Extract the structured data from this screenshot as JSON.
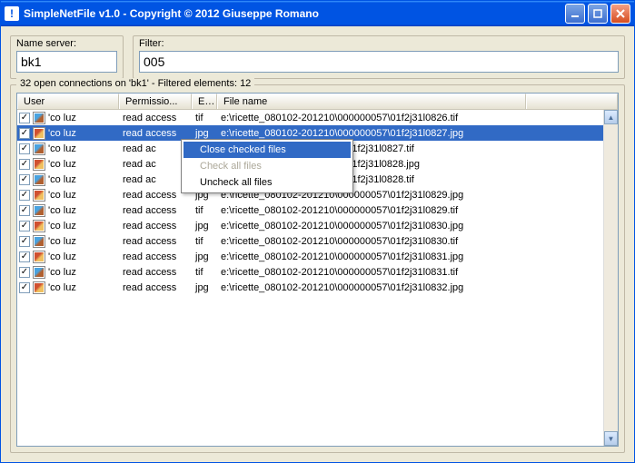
{
  "window": {
    "title": "SimpleNetFile v1.0 - Copyright © 2012 Giuseppe Romano"
  },
  "inputs": {
    "name_server_label": "Name server:",
    "name_server_value": "bk1",
    "filter_label": "Filter:",
    "filter_value": "005"
  },
  "group": {
    "legend": "32 open connections on 'bk1' - Filtered elements: 12"
  },
  "headers": {
    "user": "User",
    "perm": "Permissio...",
    "ext": "E...",
    "file": "File name"
  },
  "rows": [
    {
      "user": "luz",
      "perm": "read access",
      "ext": "tif",
      "file": "e:\\ricette_080102-201210\\000000057\\01f2j31l0826.tif",
      "type": "tif"
    },
    {
      "user": "luz",
      "perm": "read access",
      "ext": "jpg",
      "file": "e:\\ricette_080102-201210\\000000057\\01f2j31l0827.jpg",
      "type": "jpg",
      "selected": true
    },
    {
      "user": "luz",
      "perm": "read ac",
      "ext": "",
      "file": "080102-201210\\000000057\\01f2j31l0827.tif",
      "type": "tif"
    },
    {
      "user": "luz",
      "perm": "read ac",
      "ext": "",
      "file": "080102-201210\\000000057\\01f2j31l0828.jpg",
      "type": "jpg"
    },
    {
      "user": "luz",
      "perm": "read ac",
      "ext": "",
      "file": "080102-201210\\000000057\\01f2j31l0828.tif",
      "type": "tif"
    },
    {
      "user": "luz",
      "perm": "read access",
      "ext": "jpg",
      "file": "e:\\ricette_080102-201210\\000000057\\01f2j31l0829.jpg",
      "type": "jpg"
    },
    {
      "user": "luz",
      "perm": "read access",
      "ext": "tif",
      "file": "e:\\ricette_080102-201210\\000000057\\01f2j31l0829.tif",
      "type": "tif"
    },
    {
      "user": "luz",
      "perm": "read access",
      "ext": "jpg",
      "file": "e:\\ricette_080102-201210\\000000057\\01f2j31l0830.jpg",
      "type": "jpg"
    },
    {
      "user": "luz",
      "perm": "read access",
      "ext": "tif",
      "file": "e:\\ricette_080102-201210\\000000057\\01f2j31l0830.tif",
      "type": "tif"
    },
    {
      "user": "luz",
      "perm": "read access",
      "ext": "jpg",
      "file": "e:\\ricette_080102-201210\\000000057\\01f2j31l0831.jpg",
      "type": "jpg"
    },
    {
      "user": "luz",
      "perm": "read access",
      "ext": "tif",
      "file": "e:\\ricette_080102-201210\\000000057\\01f2j31l0831.tif",
      "type": "tif"
    },
    {
      "user": "luz",
      "perm": "read access",
      "ext": "jpg",
      "file": "e:\\ricette_080102-201210\\000000057\\01f2j31l0832.jpg",
      "type": "jpg"
    }
  ],
  "context_menu": {
    "close": "Close checked files",
    "check_all": "Check all files",
    "uncheck_all": "Uncheck all files"
  }
}
